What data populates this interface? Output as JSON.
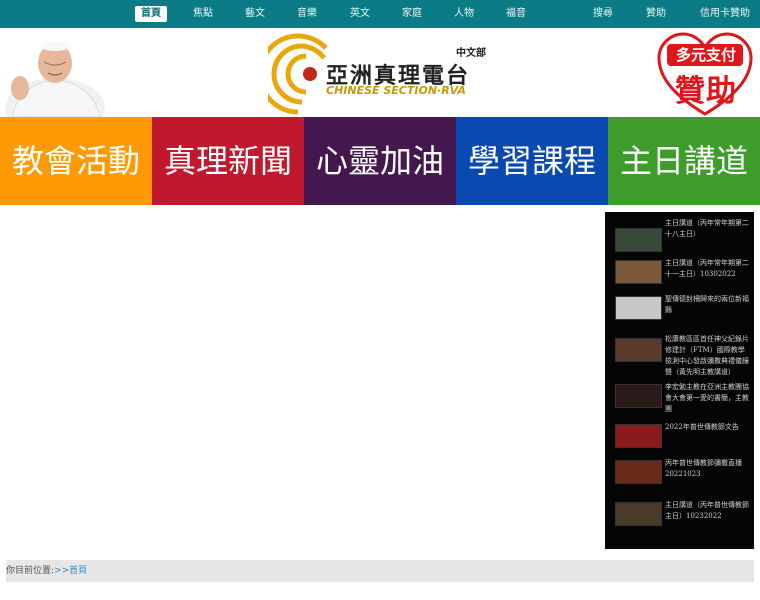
{
  "nav": {
    "items": [
      "首頁",
      "焦點",
      "藝文",
      "音樂",
      "英文",
      "家庭",
      "人物",
      "福音",
      "搜尋",
      "贊助",
      "信用卡贊助"
    ],
    "active": "首頁"
  },
  "header": {
    "logo_title": "亞洲真理電台",
    "logo_subtitle": "CHINESE SECTION·RVA",
    "logo_dept": "中文部",
    "donate_top": "多元支付",
    "donate_big": "贊助"
  },
  "categories": [
    {
      "label": "教會活動",
      "color": "#ff9a05"
    },
    {
      "label": "真理新聞",
      "color": "#c0192d"
    },
    {
      "label": "心靈加油",
      "color": "#44174e"
    },
    {
      "label": "學習課程",
      "color": "#0b49b2"
    },
    {
      "label": "主日講道",
      "color": "#3d9c2a"
    }
  ],
  "sidebar": {
    "items": [
      {
        "text": "主日講道（丙年常年期第二十八主日）",
        "thumb_color": "#3a4a3a"
      },
      {
        "text": "主日講道（丙年常年期第二十一主日）10302022",
        "thumb_color": "#7a5a3a"
      },
      {
        "text": "聖傳德封柵歸來的兩位新福縣",
        "thumb_color": "#c8c8c8"
      },
      {
        "text": "松康教區區首任神父紀錄片修建計（FTM）國際教學檢測中心發啟彌撒典禮儀鐘聲（黃先明主教講道）",
        "thumb_color": "#5a3a2a"
      },
      {
        "text": "李宏勉主教在亞洲主教團協會大會第一愛的書簡，主教團",
        "thumb_color": "#2a1a1a"
      },
      {
        "text": "2022年普世傳教節文告",
        "thumb_color": "#8a1a1a"
      },
      {
        "text": "丙年普世傳教節彌撒直播20221023",
        "thumb_color": "#6a2a1a"
      },
      {
        "text": "主日講道（丙年普世傳教節主日）10232022",
        "thumb_color": "#4a3a2a"
      }
    ]
  },
  "breadcrumb": {
    "prefix": "你目前位置:",
    "sep": ">>",
    "current": "首頁"
  },
  "bottom_text": ""
}
